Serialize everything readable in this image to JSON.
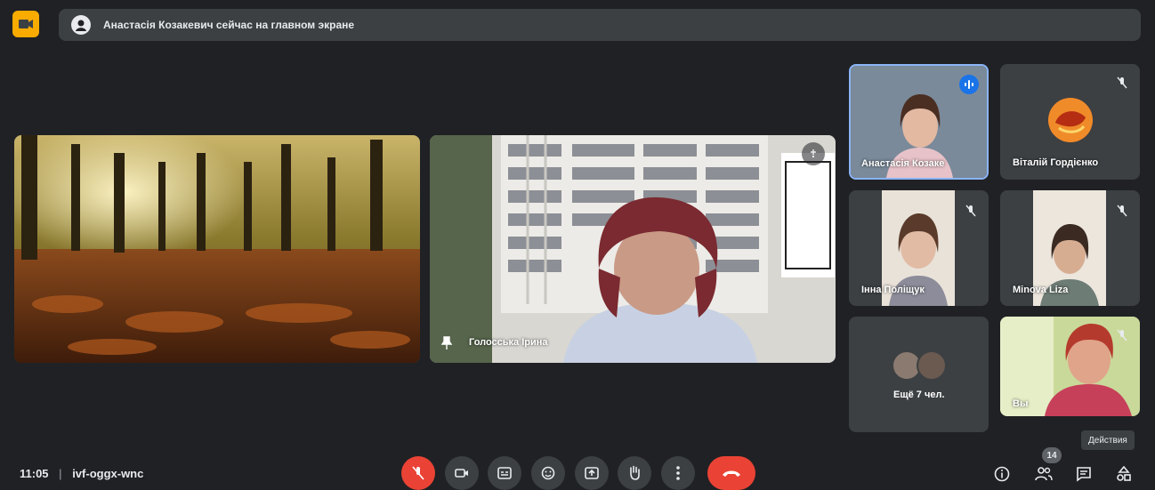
{
  "notification": {
    "message": "Анастасія Козакевич сейчас на главном экране"
  },
  "main_tiles": [
    {
      "name": "",
      "kind": "autumn-forest-image"
    },
    {
      "name": "Голосська Ірина",
      "kind": "presenter-video"
    }
  ],
  "side_tiles": [
    {
      "name": "Анастасія Козаке",
      "speaking": true
    },
    {
      "name": "Віталій Гордієнко",
      "muted": true
    },
    {
      "name": "Інна Поліщук",
      "muted": true
    },
    {
      "name": "Minova Liza",
      "muted": true
    },
    {
      "name": "Ещё 7 чел."
    },
    {
      "name": "Вы",
      "muted": true
    }
  ],
  "bottom": {
    "time": "11:05",
    "separator": "|",
    "meeting_code": "ivf-oggx-wnc",
    "participants_count": "14",
    "tooltip": "Действия"
  },
  "colors": {
    "background": "#202124",
    "surface": "#3c4043",
    "danger": "#ea4335",
    "accent": "#8ab4f8",
    "logo": "#f9ab00"
  }
}
